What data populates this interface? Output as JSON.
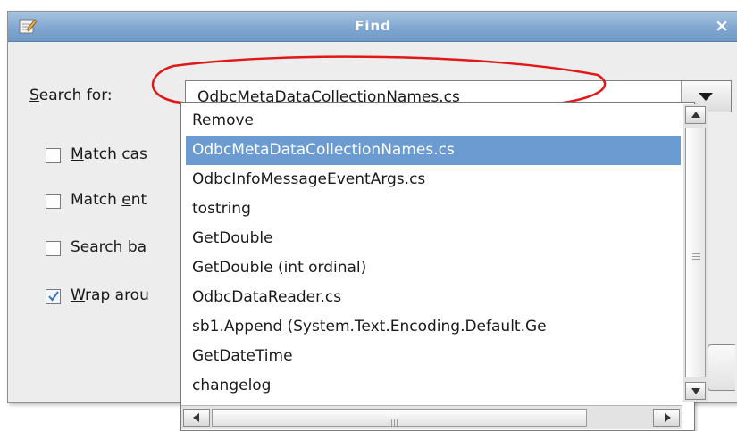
{
  "window": {
    "title": "Find",
    "close_glyph": "×",
    "app_icon": "pencil-notepad-icon"
  },
  "search": {
    "label_prefix": "",
    "label_accel": "S",
    "label_rest": "earch for:",
    "value": "OdbcMetaDataCollectionNames.cs",
    "annotation_color": "#e01818"
  },
  "options": [
    {
      "accel": "M",
      "rest": "atch cas",
      "pre": "",
      "checked": false
    },
    {
      "pre": "Match ",
      "accel": "e",
      "rest": "nt",
      "checked": false
    },
    {
      "pre": "Search ",
      "accel": "b",
      "rest": "a",
      "checked": false
    },
    {
      "accel": "W",
      "rest": "rap arou",
      "pre": "",
      "checked": true
    }
  ],
  "dropdown": {
    "items": [
      "Remove",
      "OdbcMetaDataCollectionNames.cs",
      "OdbcInfoMessageEventArgs.cs",
      "tostring",
      "GetDouble",
      "GetDouble (int ordinal)",
      "OdbcDataReader.cs",
      "sb1.Append (System.Text.Encoding.Default.Ge",
      "GetDateTime",
      "changelog"
    ],
    "selected_index": 1,
    "selection_color": "#6b9bd1"
  },
  "icons": {
    "dropdown_arrow": "chevron-down-icon",
    "scroll_up": "arrow-up-icon",
    "scroll_down": "arrow-down-icon",
    "scroll_left": "arrow-left-icon",
    "scroll_right": "arrow-right-icon",
    "check": "check-icon"
  }
}
